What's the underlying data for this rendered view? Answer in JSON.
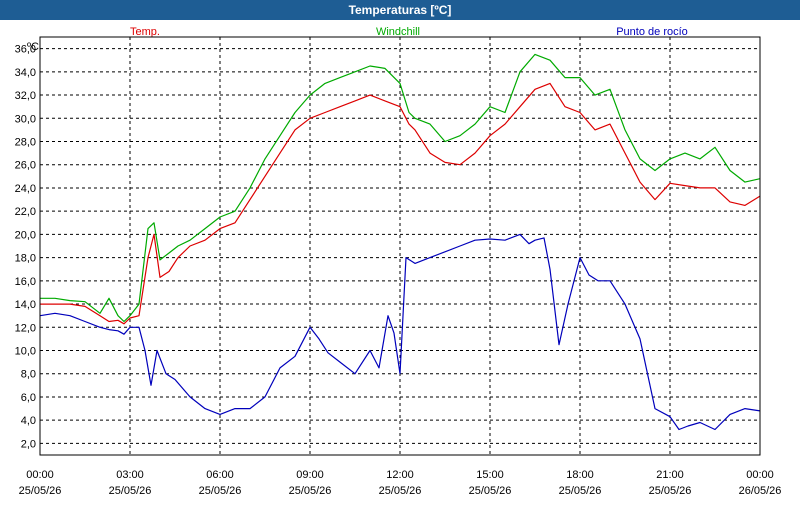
{
  "window_title": "Temperaturas [ºC]",
  "chart_data": {
    "type": "line",
    "unit_label": "ºC",
    "ylim": [
      1.0,
      37.0
    ],
    "y_ticks": [
      2,
      4,
      6,
      8,
      10,
      12,
      14,
      16,
      18,
      20,
      22,
      24,
      26,
      28,
      30,
      32,
      34,
      36
    ],
    "y_tick_labels": [
      "2,0",
      "4,0",
      "6,0",
      "8,0",
      "10,0",
      "12,0",
      "14,0",
      "16,0",
      "18,0",
      "20,0",
      "22,0",
      "24,0",
      "26,0",
      "28,0",
      "30,0",
      "32,0",
      "34,0",
      "36,0"
    ],
    "xlim": [
      0,
      24
    ],
    "x_ticks": [
      0,
      3,
      6,
      9,
      12,
      15,
      18,
      21,
      24
    ],
    "x_tick_labels": [
      {
        "time": "00:00",
        "date": "25/05/26"
      },
      {
        "time": "03:00",
        "date": "25/05/26"
      },
      {
        "time": "06:00",
        "date": "25/05/26"
      },
      {
        "time": "09:00",
        "date": "25/05/26"
      },
      {
        "time": "12:00",
        "date": "25/05/26"
      },
      {
        "time": "15:00",
        "date": "25/05/26"
      },
      {
        "time": "18:00",
        "date": "25/05/26"
      },
      {
        "time": "21:00",
        "date": "25/05/26"
      },
      {
        "time": "00:00",
        "date": "26/05/26"
      }
    ],
    "grid": true,
    "series": [
      {
        "name": "Temp.",
        "color": "#dd0000",
        "x": [
          0,
          0.5,
          1,
          1.5,
          2,
          2.3,
          2.6,
          2.8,
          3,
          3.3,
          3.6,
          3.8,
          4,
          4.3,
          4.6,
          5,
          5.5,
          6,
          6.5,
          7,
          7.5,
          8,
          8.5,
          9,
          9.5,
          10,
          10.5,
          11,
          11.5,
          12,
          12.3,
          12.5,
          13,
          13.5,
          14,
          14.5,
          15,
          15.5,
          16,
          16.5,
          17,
          17.5,
          18,
          18.5,
          19,
          19.5,
          20,
          20.5,
          21,
          21.5,
          22,
          22.5,
          23,
          23.5,
          24
        ],
        "y": [
          14,
          14,
          14,
          13.8,
          13,
          12.5,
          12.6,
          12.3,
          12.8,
          13,
          18,
          20,
          16.3,
          16.8,
          18,
          19,
          19.5,
          20.5,
          21,
          23,
          25,
          27,
          29,
          30,
          30.5,
          31,
          31.5,
          32,
          31.5,
          31,
          29.5,
          29,
          27,
          26.2,
          26,
          27,
          28.5,
          29.5,
          31,
          32.5,
          33,
          31,
          30.5,
          29,
          29.5,
          27,
          24.5,
          23,
          24.4,
          24.2,
          24,
          24,
          22.8,
          22.5,
          23.3
        ]
      },
      {
        "name": "Windchill",
        "color": "#00aa00",
        "x": [
          0,
          0.5,
          1,
          1.5,
          2,
          2.3,
          2.6,
          2.8,
          3,
          3.3,
          3.6,
          3.8,
          4,
          4.3,
          4.6,
          5,
          5.5,
          6,
          6.5,
          7,
          7.5,
          8,
          8.5,
          9,
          9.5,
          10,
          10.5,
          11,
          11.5,
          12,
          12.3,
          12.5,
          13,
          13.5,
          14,
          14.5,
          15,
          15.5,
          16,
          16.5,
          17,
          17.5,
          18,
          18.5,
          19,
          19.5,
          20,
          20.5,
          21,
          21.5,
          22,
          22.5,
          23,
          23.5,
          24
        ],
        "y": [
          14.5,
          14.5,
          14.3,
          14.2,
          13.2,
          14.5,
          13,
          12.5,
          13,
          14,
          20.5,
          21,
          17.8,
          18.4,
          19,
          19.5,
          20.5,
          21.5,
          22,
          24,
          26.5,
          28.5,
          30.5,
          32,
          33,
          33.5,
          34,
          34.5,
          34.3,
          33,
          30.5,
          30,
          29.5,
          28,
          28.5,
          29.5,
          31,
          30.5,
          34,
          35.5,
          35,
          33.5,
          33.5,
          32,
          32.5,
          29,
          26.5,
          25.5,
          26.5,
          27,
          26.5,
          27.5,
          25.5,
          24.5,
          24.8
        ]
      },
      {
        "name": "Punto de rocío",
        "color": "#0000bb",
        "x": [
          0,
          0.5,
          1,
          1.5,
          2,
          2.3,
          2.6,
          2.8,
          3,
          3.3,
          3.5,
          3.7,
          3.9,
          4.2,
          4.5,
          5,
          5.5,
          6,
          6.5,
          7,
          7.5,
          8,
          8.5,
          9,
          9.3,
          9.6,
          10,
          10.5,
          11,
          11.3,
          11.6,
          11.8,
          12,
          12.2,
          12.5,
          13,
          13.5,
          14,
          14.5,
          15,
          15.5,
          16,
          16.3,
          16.5,
          16.8,
          17,
          17.3,
          17.6,
          18,
          18.3,
          18.6,
          19,
          19.5,
          20,
          20.5,
          21,
          21.3,
          21.6,
          22,
          22.5,
          23,
          23.5,
          24
        ],
        "y": [
          13,
          13.2,
          13,
          12.5,
          12,
          11.8,
          11.7,
          11.4,
          12,
          12,
          10,
          7,
          10,
          8,
          7.5,
          6,
          5,
          4.5,
          5,
          5,
          6,
          8.5,
          9.5,
          12,
          11,
          9.8,
          9,
          8,
          10,
          8.5,
          13,
          11.5,
          8,
          18,
          17.5,
          18,
          18.5,
          19,
          19.5,
          19.6,
          19.5,
          20,
          19.2,
          19.5,
          19.7,
          17,
          10.5,
          14,
          18,
          16.5,
          16,
          16,
          14,
          11,
          5,
          4.3,
          3.2,
          3.5,
          3.8,
          3.2,
          4.5,
          5,
          4.8
        ]
      }
    ]
  }
}
